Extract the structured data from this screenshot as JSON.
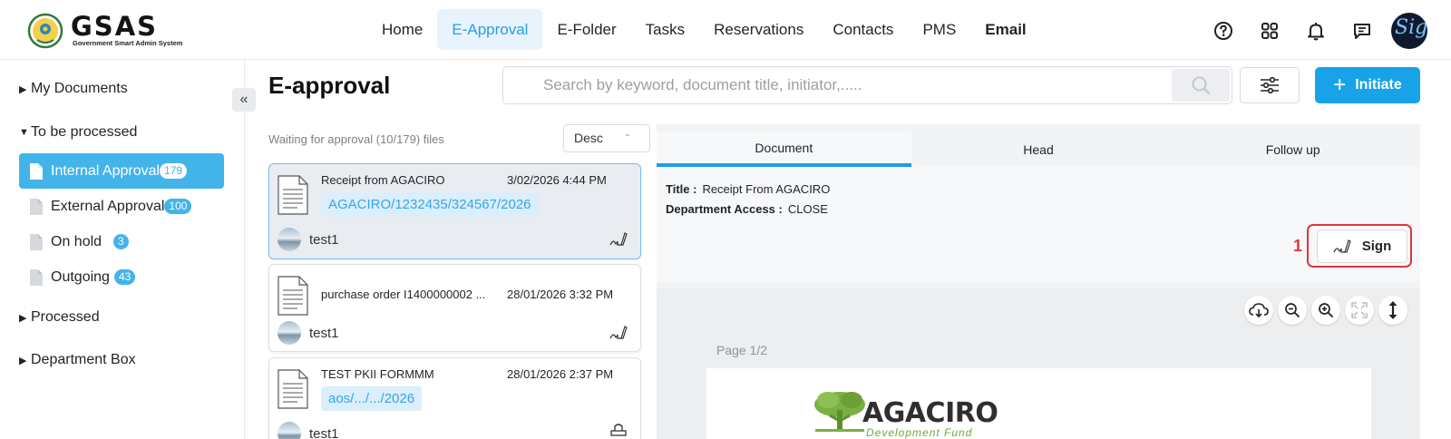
{
  "brand": {
    "name": "GSAS",
    "tagline": "Government Smart Admin System"
  },
  "nav": [
    {
      "label": "Home",
      "active": false
    },
    {
      "label": "E-Approval",
      "active": true
    },
    {
      "label": "E-Folder",
      "active": false
    },
    {
      "label": "Tasks",
      "active": false
    },
    {
      "label": "Reservations",
      "active": false
    },
    {
      "label": "Contacts",
      "active": false
    },
    {
      "label": "PMS",
      "active": false
    },
    {
      "label": "Email",
      "active": false
    }
  ],
  "top_icons": [
    "help-icon",
    "apps-grid-icon",
    "bell-icon",
    "chat-icon"
  ],
  "avatar_text": "Sig",
  "sidebar": {
    "sections": {
      "my_documents": "My Documents",
      "to_be_processed": "To be processed",
      "processed": "Processed",
      "department_box": "Department Box"
    },
    "items": [
      {
        "label": "Internal Approval",
        "count": "179",
        "active": true
      },
      {
        "label": "External Approval",
        "count": "100",
        "active": false
      },
      {
        "label": "On hold",
        "count": "3",
        "active": false
      },
      {
        "label": "Outgoing",
        "count": "43",
        "active": false
      }
    ]
  },
  "main": {
    "title": "E-approval",
    "search_placeholder": "Search by keyword, document title, initiator,.....",
    "initiate_label": "Initiate",
    "waiting_text": "Waiting for approval (10/179) files",
    "sort_value": "Desc"
  },
  "documents": [
    {
      "title": "Receipt from AGACIRO",
      "date": "3/02/2026 4:44 PM",
      "ref": "AGACIRO/1232435/324567/2026",
      "user": "test1",
      "selected": true
    },
    {
      "title": "purchase order I1400000002 ...",
      "date": "28/01/2026 3:32 PM",
      "ref": "",
      "user": "test1",
      "selected": false
    },
    {
      "title": "TEST PKII FORMMM",
      "date": "28/01/2026 2:37 PM",
      "ref": "aos/.../.../2026",
      "user": "test1",
      "selected": false
    }
  ],
  "detail": {
    "tabs": [
      "Document",
      "Head",
      "Follow up"
    ],
    "active_tab": "Document",
    "title_label": "Title :",
    "title_value": "Receipt From AGACIRO",
    "access_label": "Department Access :",
    "access_value": "CLOSE",
    "sign_label": "Sign",
    "marker": "1",
    "page_label": "Page 1/2",
    "viewer_tools": [
      "cloud-download-icon",
      "zoom-out-icon",
      "zoom-in-icon",
      "fit-screen-icon",
      "vertical-expand-icon"
    ],
    "letterhead_name": "AGACIRO",
    "letterhead_sub": "Development Fund"
  },
  "colors": {
    "accent": "#18a3e8",
    "active_nav_bg": "#e8f4fd",
    "highlight": "#e5333b",
    "sidebar_active": "#43b4ea"
  }
}
